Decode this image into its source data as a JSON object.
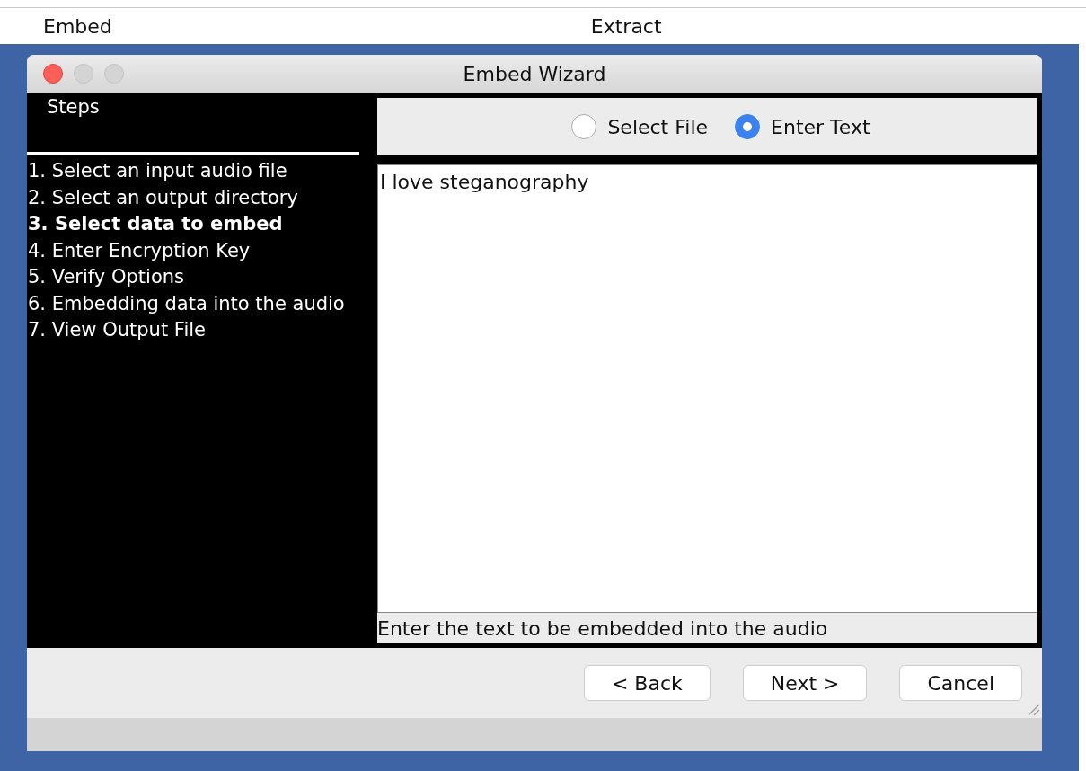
{
  "tabs": [
    {
      "label": "Embed"
    },
    {
      "label": "Extract"
    }
  ],
  "window": {
    "title": "Embed Wizard"
  },
  "steps": {
    "heading": "Steps",
    "items": [
      {
        "label": "1. Select an input audio file",
        "selected": false
      },
      {
        "label": "2. Select an output directory",
        "selected": false
      },
      {
        "label": "3. Select data to embed",
        "selected": true
      },
      {
        "label": "4. Enter Encryption Key",
        "selected": false
      },
      {
        "label": "5. Verify Options",
        "selected": false
      },
      {
        "label": "6. Embedding data into the audio",
        "selected": false
      },
      {
        "label": "7. View Output File",
        "selected": false
      }
    ]
  },
  "source_options": [
    {
      "label": "Select File",
      "selected": false
    },
    {
      "label": "Enter Text",
      "selected": true
    }
  ],
  "text_area": {
    "value": "I love steganography"
  },
  "hint": "Enter the text to be embedded into the audio",
  "buttons": [
    "< Back",
    "Next >",
    "Cancel"
  ]
}
